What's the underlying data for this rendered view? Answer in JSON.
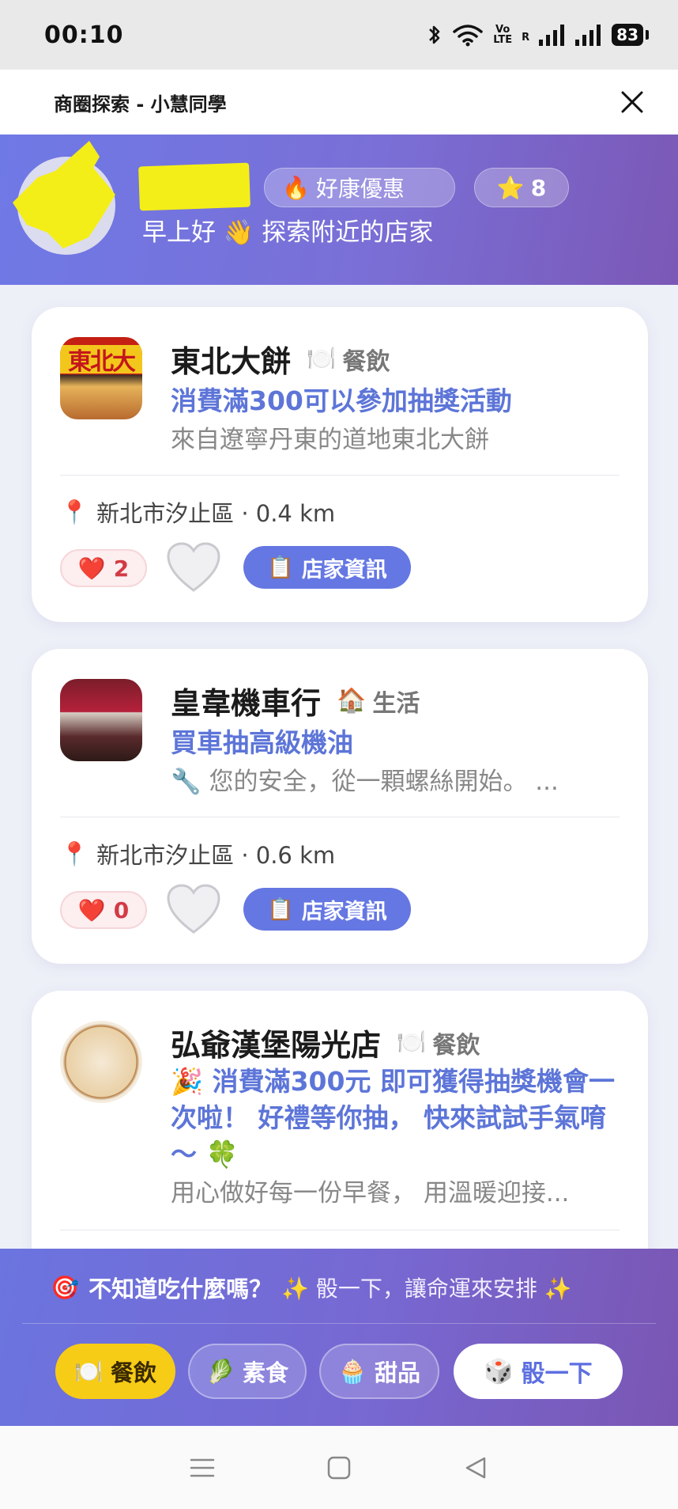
{
  "status_bar": {
    "time": "00:10",
    "network_label_top": "Vo",
    "network_label_bottom": "LTE",
    "roaming": "R",
    "battery": "83"
  },
  "title_bar": {
    "title": "商圈探索 - 小慧同學",
    "close_icon": "close-icon"
  },
  "header": {
    "deals_pill": "好康優惠",
    "deals_emoji": "🔥",
    "stars_emoji": "⭐",
    "stars_count": "8",
    "greeting": "早上好 👋 探索附近的店家",
    "colors": {
      "gradient_start": "#6f79e6",
      "gradient_end": "#7b58b6"
    }
  },
  "stores": [
    {
      "name": "東北大餅",
      "category_emoji": "🍽️",
      "category": "餐飲",
      "promo": "消費滿300可以參加抽獎活動",
      "description": "來自遼寧丹東的道地東北大餅",
      "location_emoji": "📍",
      "location": "新北市汐止區 · 0.4 km",
      "likes": "2",
      "info_button": "店家資訊",
      "thumb_sign": "東北大"
    },
    {
      "name": "皇韋機車行",
      "category_emoji": "🏠",
      "category": "生活",
      "promo": "買車抽高級機油",
      "description": "🔧 您的安全，從一顆螺絲開始。 ...",
      "location_emoji": "📍",
      "location": "新北市汐止區 · 0.6 km",
      "likes": "0",
      "info_button": "店家資訊"
    },
    {
      "name": "弘爺漢堡陽光店",
      "category_emoji": "🍽️",
      "category": "餐飲",
      "promo": "🎉 消費滿300元 即可獲得抽獎機會一次啦！ 好禮等你抽， 快來試試手氣唷～ 🍀",
      "description": "用心做好每一份早餐， 用溫暖迎接..."
    }
  ],
  "dice_bar": {
    "target_emoji": "🎯",
    "question": "不知道吃什麼嗎？",
    "subtitle": "✨ 骰一下，讓命運來安排 ✨",
    "chips": [
      {
        "emoji": "🍽️",
        "label": "餐飲",
        "selected": true
      },
      {
        "emoji": "🥬",
        "label": "素食",
        "selected": false
      },
      {
        "emoji": "🧁",
        "label": "甜品",
        "selected": false
      }
    ],
    "dice_emoji": "🎲",
    "dice_button": "骰一下",
    "colors": {
      "selected_chip": "#f7cc16",
      "button_text": "#5d6fe0"
    }
  },
  "nav_bar": {
    "icons": [
      "menu-icon",
      "home-icon",
      "back-icon"
    ]
  }
}
